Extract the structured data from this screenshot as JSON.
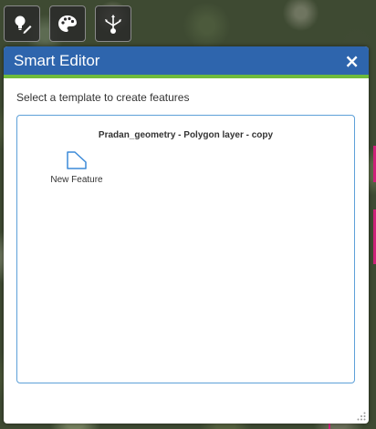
{
  "toolbar": {
    "tools": [
      {
        "name": "edit-tool",
        "icon": "lightbulb-pencil-icon"
      },
      {
        "name": "style-tool",
        "icon": "palette-icon"
      },
      {
        "name": "share-tool",
        "icon": "share-nodes-icon"
      }
    ]
  },
  "panel": {
    "title": "Smart Editor",
    "close_label": "×",
    "instruction": "Select a template to create features",
    "layer_name": "Pradan_geometry - Polygon layer - copy",
    "templates": [
      {
        "label": "New Feature",
        "icon": "polygon-icon"
      }
    ]
  },
  "colors": {
    "header": "#2e65ad",
    "header_underline": "#6fbb3c",
    "template_border": "#5da0d8",
    "polygon_icon": "#3b8ad8",
    "map_line": "#d0207a"
  }
}
